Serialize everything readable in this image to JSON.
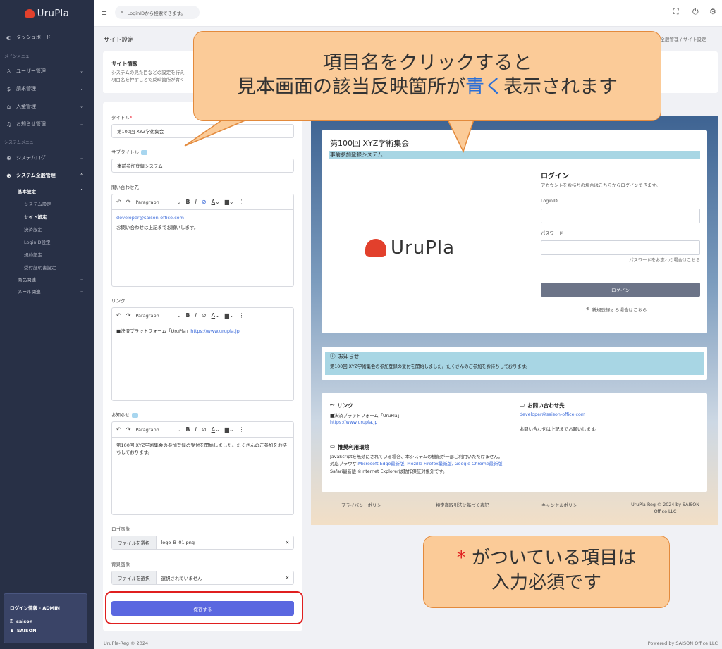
{
  "brand": {
    "name": "UruPla"
  },
  "topbar": {
    "search_placeholder": "LoginIDから検索できます。"
  },
  "sidebar": {
    "dashboard": "ダッシュボード",
    "main_menu_section": "メインメニュー",
    "user_mgmt": "ユーザー管理",
    "billing": "請求管理",
    "payment": "入金管理",
    "notice_mgmt": "お知らせ管理",
    "system_menu_section": "システムメニュー",
    "system_log": "システムログ",
    "system_all": "システム全般管理",
    "basic_settings": "基本設定",
    "sub_items": [
      "システム設定",
      "サイト設定",
      "決済設定",
      "LoginID設定",
      "規約設定",
      "受付証明書設定"
    ],
    "product": "商品関連",
    "mail": "メール関連",
    "login_info": {
      "title": "ログイン情報 - ADMIN",
      "user": "saison",
      "org": "SAISON"
    }
  },
  "page": {
    "title": "サイト設定",
    "breadcrumb": "ム全般管理 / サイト設定",
    "info_title": "サイト情報",
    "info_desc_1": "システムの見た目などの設定を行え",
    "info_desc_2": "項目名を押すことで反映箇所が青く"
  },
  "form": {
    "title_label": "タイトル",
    "title_required": "*",
    "title_value": "第100回 XYZ学術集会",
    "subtitle_label": "サブタイトル",
    "subtitle_value": "事前参加登録システム",
    "contact_label": "問い合わせ先",
    "contact_email": "developer@saison-office.com",
    "contact_text": "お問い合わせは上記までお願いします。",
    "link_label": "リンク",
    "link_text": "■決済プラットフォーム「UruPla」",
    "link_url": "https://www.urupla.jp",
    "notice_label": "お知らせ",
    "notice_text": "第100回 XYZ学術集会の参加登録の受付を開始しました。たくさんのご参加をお待ちしております。",
    "editor_style": "Paragraph",
    "logo_label": "ロゴ画像",
    "file_button": "ファイルを選択",
    "logo_file": "logo_B_01.png",
    "bg_label": "背景画像",
    "bg_file": "選択されていません",
    "save": "保存する"
  },
  "preview": {
    "title": "第100回 XYZ学術集会",
    "subtitle": "事前参加登録システム",
    "logo_text": "UruPla",
    "login_title": "ログイン",
    "login_desc": "アカウントをお持ちの場合はこちらからログインできます。",
    "loginid_label": "LoginID",
    "password_label": "パスワード",
    "forgot": "パスワードをお忘れの場合はこちら",
    "login_button": "ログイン",
    "register": "新規登録する場合はこちら",
    "notice_title": "お知らせ",
    "notice_text": "第100回 XYZ学術集会の参加登録の受付を開始しました。たくさんのご参加をお待ちしております。",
    "link_title": "リンク",
    "link_text": "■決済プラットフォーム「UruPla」",
    "link_url": "https://www.urupla.jp",
    "contact_title": "お問い合わせ先",
    "contact_email": "developer@saison-office.com",
    "contact_text": "お問い合わせは上記までお願いします。",
    "env_title": "推奨利用環境",
    "env_text_1": "JavaScriptを無効にされている場合、本システムの機能が一部ご利用いただけません。",
    "env_text_2_prefix": "対応ブラウザ:",
    "env_browsers": "Microsoft Edge最新版, Mozilla Firefox最新版, Google Chrome最新版",
    "env_text_2_suffix": ", Safari最新版 ※Internet Explorerは動作保証対象外です。",
    "footer_links": [
      "プライバシーポリシー",
      "特定商取引法に基づく表記",
      "キャンセルポリシー"
    ],
    "footer_copy": "UruPla-Reg © 2024 by SAISON Office LLC"
  },
  "callouts": {
    "top_line1": "項目名をクリックすると",
    "top_line2_a": "見本画面の該当反映箇所が",
    "top_line2_blue": "青く",
    "top_line2_b": "表示されます",
    "bottom_star": "*",
    "bottom_line1": "がついている項目は",
    "bottom_line2": "入力必須です"
  },
  "footer": {
    "left": "UruPla-Reg © 2024",
    "right": "Powered by SAISON Office LLC"
  },
  "colors": {
    "sidebar": "#283046",
    "primary": "#5a67e0",
    "highlight": "#a8d6e4",
    "callout": "#fbcb98",
    "required": "#e01f1f"
  }
}
